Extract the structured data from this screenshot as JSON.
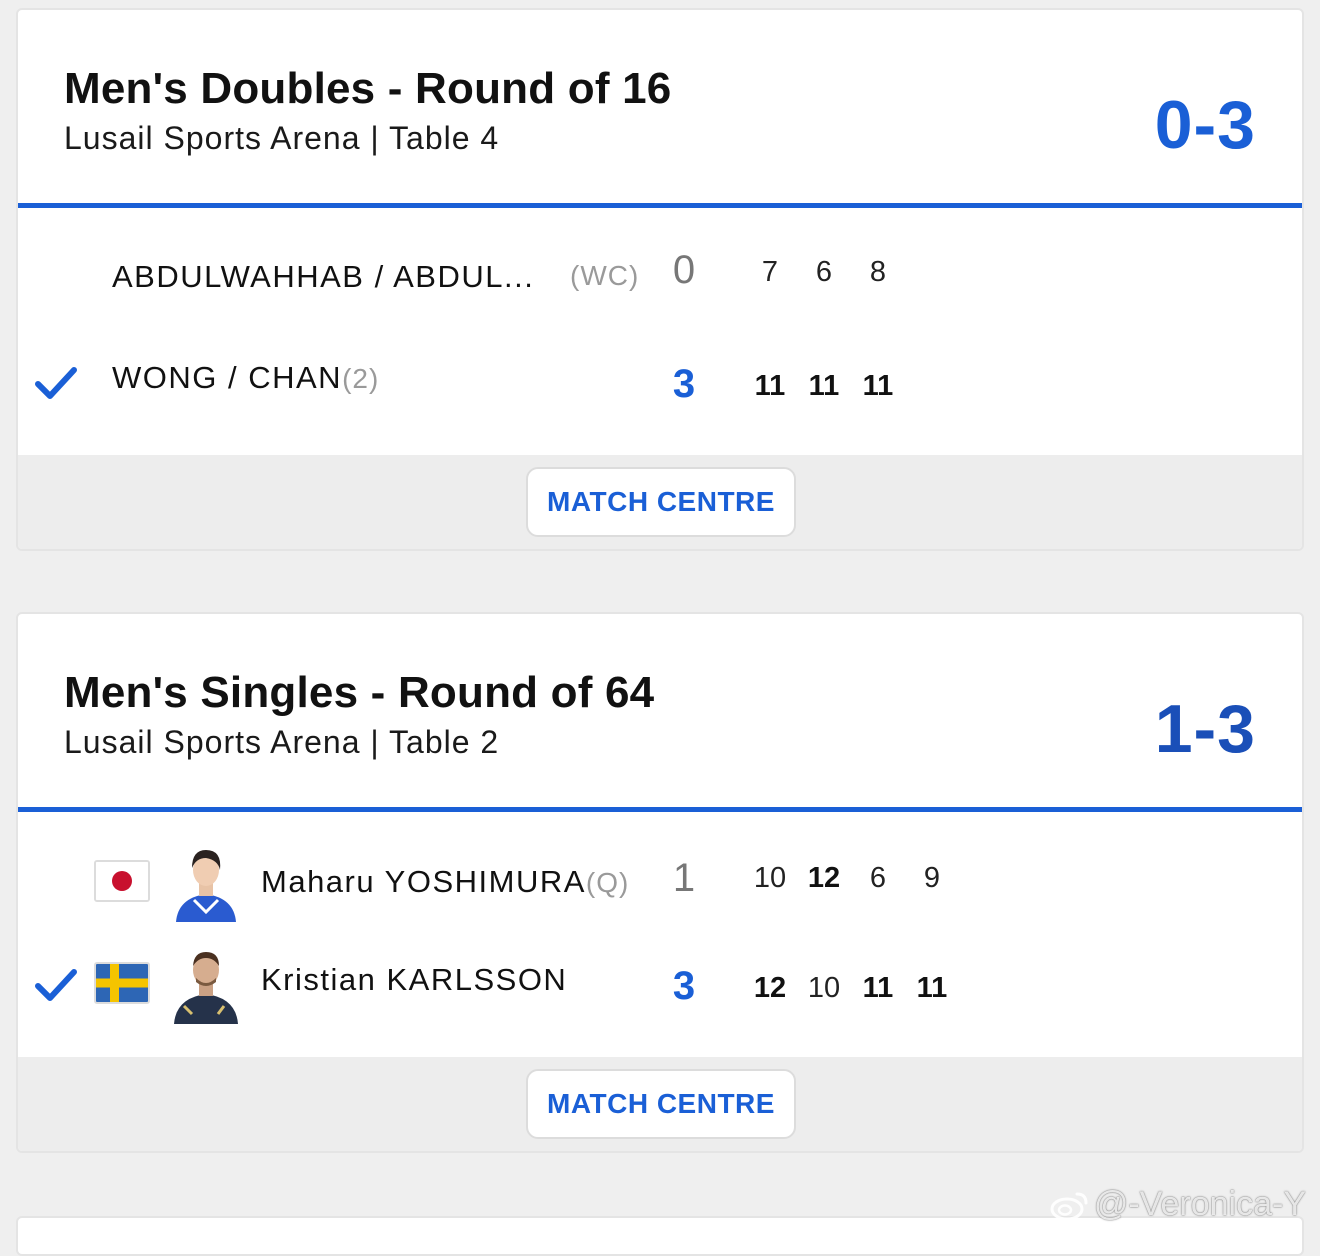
{
  "matches": [
    {
      "title": "Men's Doubles - Round of 16",
      "venue": "Lusail Sports Arena | Table 4",
      "score": "0-3",
      "button_label": "MATCH CENTRE",
      "players": [
        {
          "name": "ABDULWAHHAB / ABDUL...",
          "seed": "(WC)",
          "sets": "0",
          "games": [
            "7",
            "6",
            "8"
          ],
          "winner": false
        },
        {
          "name": "WONG / CHAN",
          "seed": "(2)",
          "sets": "3",
          "games": [
            "11",
            "11",
            "11"
          ],
          "winner": true
        }
      ]
    },
    {
      "title": "Men's Singles - Round of 64",
      "venue": "Lusail Sports Arena | Table 2",
      "score": "1-3",
      "button_label": "MATCH CENTRE",
      "players": [
        {
          "name": "Maharu YOSHIMURA",
          "seed": "(Q)",
          "flag": "japan-flag",
          "sets": "1",
          "games": [
            "10",
            "12",
            "6",
            "9"
          ],
          "winner": false
        },
        {
          "name": "Kristian KARLSSON",
          "seed": "",
          "flag": "sweden-flag",
          "sets": "3",
          "games": [
            "12",
            "10",
            "11",
            "11"
          ],
          "winner": true
        }
      ]
    }
  ],
  "watermark": "@-Veronica-Y",
  "colors": {
    "accent": "#1a5fd6",
    "footer_bg": "#ededed",
    "page_bg": "#efefef"
  }
}
